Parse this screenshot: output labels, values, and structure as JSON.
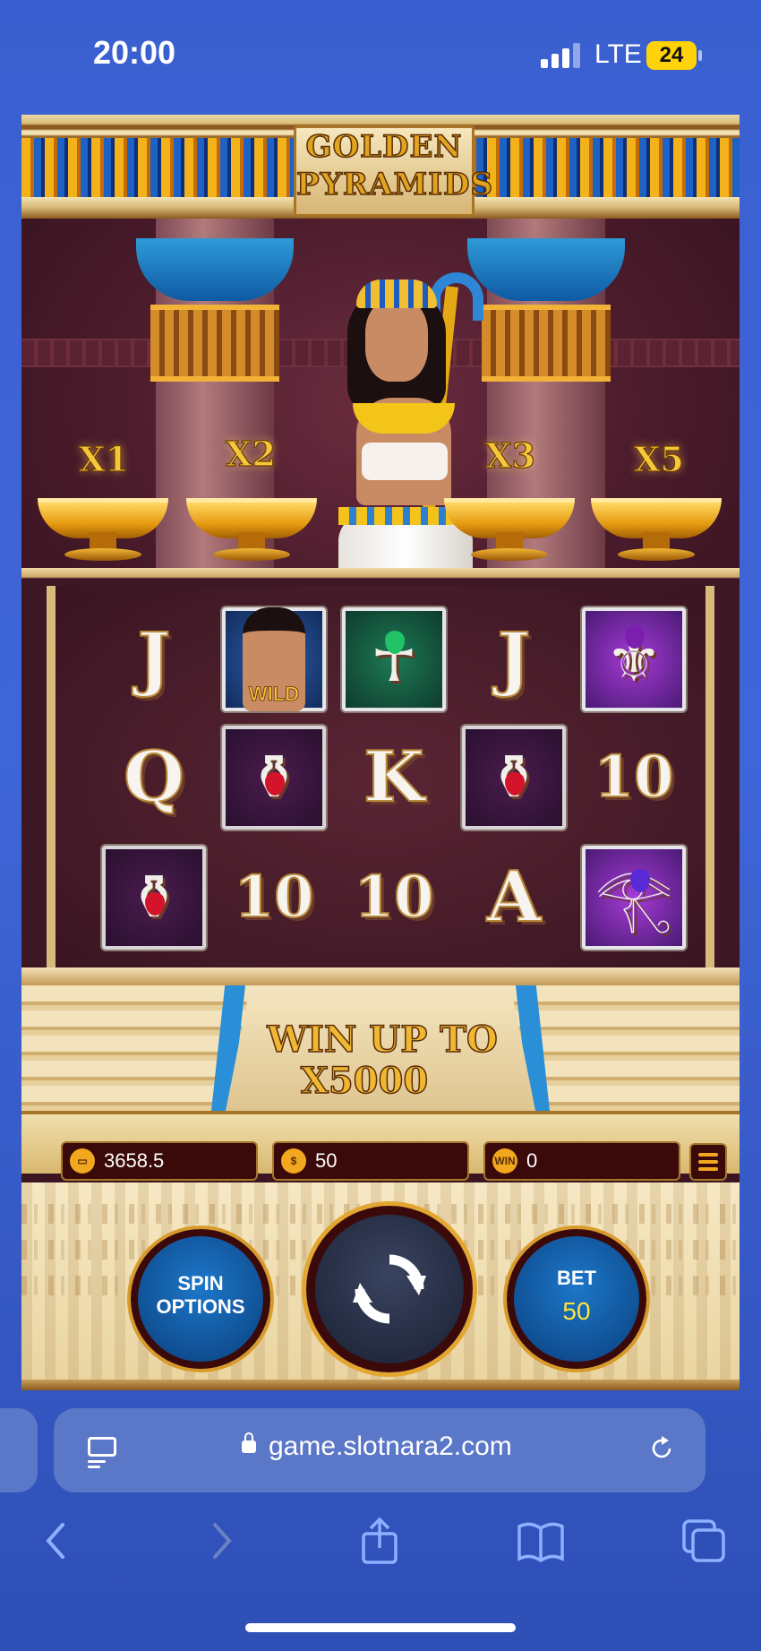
{
  "status_bar": {
    "time": "20:00",
    "network": "LTE",
    "battery": "24"
  },
  "game": {
    "title_line1": "GOLDEN",
    "title_line2": "PYRAMIDS",
    "multipliers": [
      "X1",
      "X2",
      "X3",
      "X5"
    ],
    "reels": [
      [
        {
          "symbol": "J",
          "frame": "none"
        },
        {
          "symbol": "Q",
          "frame": "none"
        },
        {
          "symbol": "ankh-red",
          "frame": "red",
          "icon": "red-gem-urn-icon"
        }
      ],
      [
        {
          "symbol": "WILD",
          "frame": "wild",
          "icon": "queen-wild-icon"
        },
        {
          "symbol": "ankh-red",
          "frame": "red",
          "icon": "red-gem-urn-icon"
        },
        {
          "symbol": "10",
          "frame": "none"
        }
      ],
      [
        {
          "symbol": "ankh-green",
          "frame": "green",
          "icon": "green-ankh-icon"
        },
        {
          "symbol": "K",
          "frame": "none"
        },
        {
          "symbol": "10",
          "frame": "none"
        }
      ],
      [
        {
          "symbol": "J",
          "frame": "none"
        },
        {
          "symbol": "ankh-red",
          "frame": "red",
          "icon": "red-gem-urn-icon"
        },
        {
          "symbol": "A",
          "frame": "none"
        }
      ],
      [
        {
          "symbol": "lotus-purple",
          "frame": "purple",
          "icon": "purple-lotus-icon"
        },
        {
          "symbol": "10",
          "frame": "none"
        },
        {
          "symbol": "eye-purple",
          "frame": "purple",
          "icon": "eye-of-horus-icon"
        }
      ]
    ],
    "promo_line1": "WIN UP TO",
    "promo_line2": "X5000",
    "balance": "3658.5",
    "bet_value": "50",
    "win_label": "WIN",
    "win_value": "0",
    "spin_options_line1": "SPIN",
    "spin_options_line2": "OPTIONS",
    "bet_label": "BET",
    "bet_amount": "50"
  },
  "browser": {
    "url": "game.slotnara2.com"
  },
  "colors": {
    "accent_blue": "#3f66d8",
    "gold": "#f0b733",
    "maroon": "#3a0a0a"
  }
}
